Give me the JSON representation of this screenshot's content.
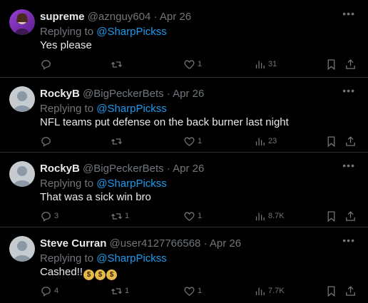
{
  "replies": [
    {
      "name": "supreme",
      "handle": "@aznguy604",
      "sep": "·",
      "date": "Apr 26",
      "replying_prefix": "Replying to ",
      "replying_to": "@SharpPickss",
      "text": "Yes please",
      "reply_count": "",
      "retweet_count": "",
      "like_count": "1",
      "view_count": "31",
      "avatar": "custom"
    },
    {
      "name": "RockyB",
      "handle": "@BigPeckerBets",
      "sep": "·",
      "date": "Apr 26",
      "replying_prefix": "Replying to ",
      "replying_to": "@SharpPickss",
      "text": "NFL teams put defense on the back burner last night",
      "reply_count": "",
      "retweet_count": "",
      "like_count": "1",
      "view_count": "23",
      "avatar": "default"
    },
    {
      "name": "RockyB",
      "handle": "@BigPeckerBets",
      "sep": "·",
      "date": "Apr 26",
      "replying_prefix": "Replying to ",
      "replying_to": "@SharpPickss",
      "text": "That was a sick win bro",
      "reply_count": "3",
      "retweet_count": "1",
      "like_count": "1",
      "view_count": "8.7K",
      "avatar": "default"
    },
    {
      "name": "Steve Curran",
      "handle": "@user4127766568",
      "sep": "·",
      "date": "Apr 26",
      "replying_prefix": "Replying to ",
      "replying_to": "@SharpPickss",
      "text": "Cashed!!",
      "reply_count": "4",
      "retweet_count": "1",
      "like_count": "1",
      "view_count": "7.7K",
      "avatar": "default"
    }
  ],
  "colors": {
    "background": "#000000",
    "text": "#e7e9ea",
    "muted": "#71767b",
    "link": "#1d9bf0",
    "divider": "#2f3336"
  },
  "icons": [
    "reply-icon",
    "retweet-icon",
    "like-icon",
    "views-icon",
    "bookmark-icon",
    "share-icon",
    "more-icon",
    "money-bag-icon"
  ]
}
